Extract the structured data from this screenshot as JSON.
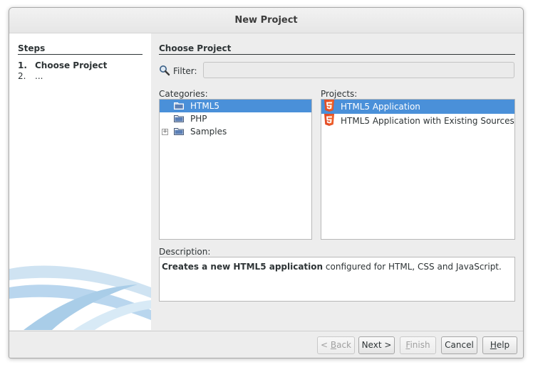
{
  "window": {
    "title": "New Project"
  },
  "steps": {
    "title": "Steps",
    "items": [
      {
        "num": "1.",
        "label": "Choose Project"
      },
      {
        "num": "2.",
        "label": "..."
      }
    ]
  },
  "main": {
    "title": "Choose Project",
    "filter": {
      "label": "Filter:",
      "value": ""
    },
    "categories": {
      "label": "Categories:",
      "items": [
        {
          "label": "HTML5",
          "selected": true
        },
        {
          "label": "PHP",
          "selected": false
        },
        {
          "label": "Samples",
          "selected": false
        }
      ]
    },
    "projects": {
      "label": "Projects:",
      "items": [
        {
          "label": "HTML5 Application",
          "selected": true
        },
        {
          "label": "HTML5 Application with Existing Sources",
          "selected": false
        }
      ]
    },
    "description": {
      "label": "Description:",
      "bold": "Creates a new HTML5 application",
      "rest": " configured for HTML, CSS and JavaScript."
    }
  },
  "buttons": {
    "back": {
      "pre": "< ",
      "mnemonic": "B",
      "post": "ack"
    },
    "next": "Next >",
    "finish": {
      "mnemonic": "F",
      "post": "inish"
    },
    "cancel": "Cancel",
    "help": {
      "mnemonic": "H",
      "post": "elp"
    }
  },
  "colors": {
    "selection": "#4a90d9",
    "html5_orange": "#e44d26",
    "folder_blue": "#5b7fb5"
  }
}
